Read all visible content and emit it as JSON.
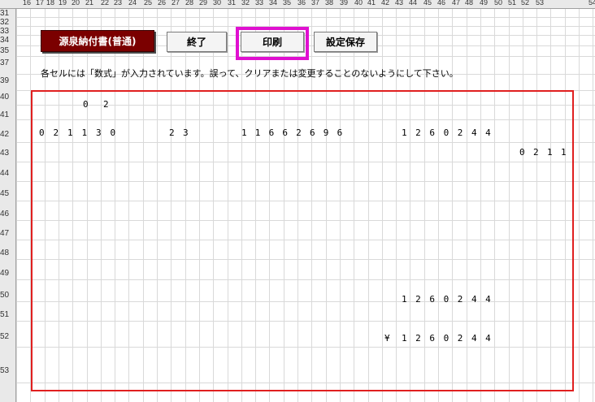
{
  "column_headers": [
    "16",
    "17",
    "18",
    "19",
    "20",
    "21",
    "22",
    "23",
    "24",
    "25",
    "26",
    "27",
    "28",
    "29",
    "30",
    "31",
    "32",
    "33",
    "34",
    "35",
    "36",
    "37",
    "38",
    "39",
    "40",
    "41",
    "42",
    "43",
    "44",
    "45",
    "46",
    "47",
    "48",
    "49",
    "50",
    "51",
    "52",
    "53",
    "54"
  ],
  "row_headers": [
    "31",
    "32",
    "33",
    "34",
    "35",
    "37",
    "39",
    "40",
    "41",
    "42",
    "43",
    "44",
    "45",
    "46",
    "47",
    "48",
    "49",
    "50",
    "51",
    "52",
    "53"
  ],
  "toolbar": {
    "gensen_label": "源泉納付書(普通)",
    "exit_label": "終了",
    "print_label": "印刷",
    "save_label": "設定保存"
  },
  "notice": "各セルには「数式」が入力されています。誤って、クリアまたは変更することのないようにして下さい。",
  "form": {
    "row40": [
      "0",
      "2"
    ],
    "row42_a": [
      "0",
      "2",
      "1",
      "1",
      "3",
      "0"
    ],
    "row42_b": [
      "2",
      "3"
    ],
    "row42_c": [
      "1",
      "1",
      "6",
      "6",
      "2",
      "6",
      "9",
      "6"
    ],
    "row42_d": [
      "1",
      "2",
      "6",
      "0",
      "2",
      "4",
      "4"
    ],
    "row43": [
      "0",
      "2",
      "1",
      "1"
    ],
    "row50": [
      "1",
      "2",
      "6",
      "0",
      "2",
      "4",
      "4"
    ],
    "row52_yen": "¥",
    "row52": [
      "1",
      "2",
      "6",
      "0",
      "2",
      "4",
      "4"
    ]
  },
  "colors": {
    "dark_button": "#7b0000",
    "highlight": "#e010d0",
    "border_red": "#e01f1f"
  }
}
